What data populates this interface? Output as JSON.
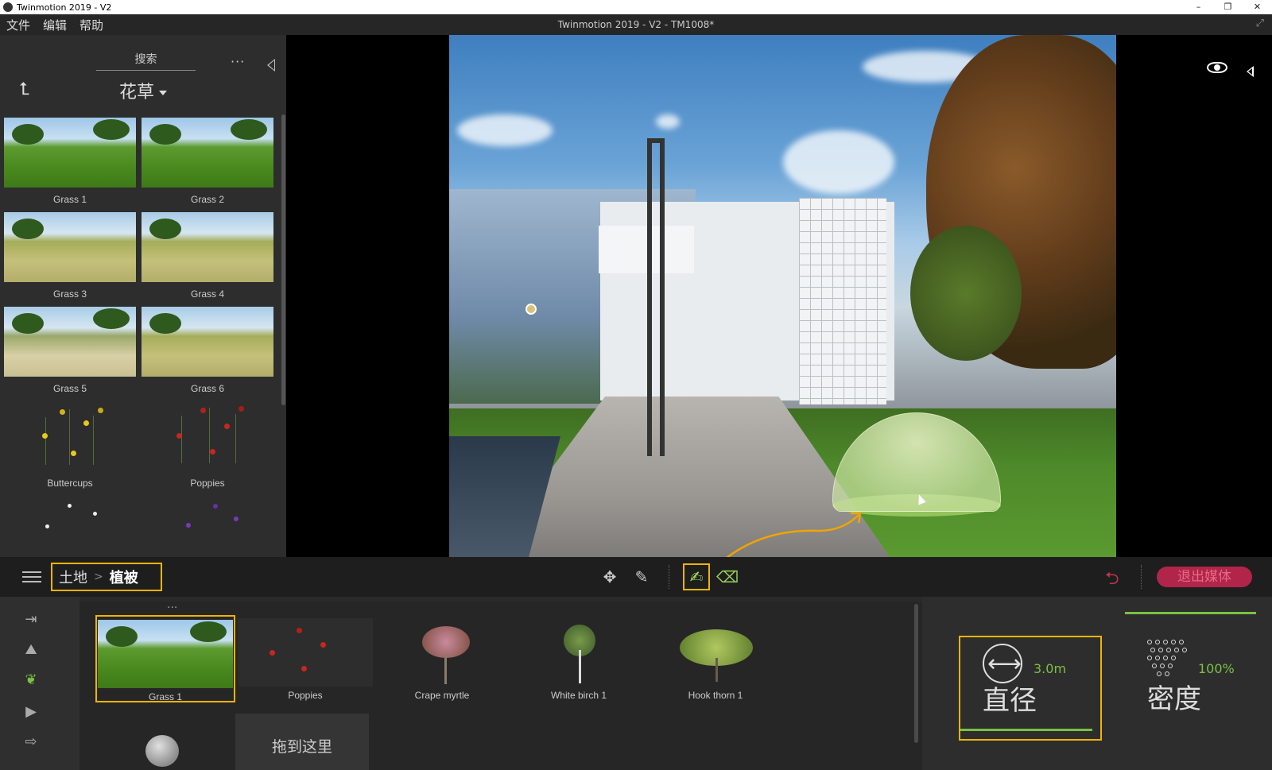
{
  "window": {
    "title": "Twinmotion 2019 - V2",
    "controls": [
      "–",
      "❐",
      "✕"
    ]
  },
  "menubar": {
    "items": [
      "文件",
      "编辑",
      "帮助"
    ],
    "doc_title": "Twinmotion 2019 - V2 - TM1008*"
  },
  "library": {
    "search_label": "搜索",
    "more_label": "···",
    "category": "花草",
    "items": [
      {
        "label": "Grass 1",
        "kind": "grass"
      },
      {
        "label": "Grass 2",
        "kind": "grass"
      },
      {
        "label": "Grass 3",
        "kind": "dry"
      },
      {
        "label": "Grass 4",
        "kind": "dry"
      },
      {
        "label": "Grass 5",
        "kind": "pale"
      },
      {
        "label": "Grass 6",
        "kind": "dry"
      },
      {
        "label": "Buttercups",
        "kind": "flower-yellow"
      },
      {
        "label": "Poppies",
        "kind": "flower-red"
      }
    ]
  },
  "toolbar": {
    "breadcrumb": [
      "土地",
      "植被"
    ],
    "exit_media_label": "退出媒体"
  },
  "assets": {
    "more_label": "···",
    "items": [
      {
        "label": "Grass 1",
        "selected": true
      },
      {
        "label": "Poppies",
        "selected": false
      },
      {
        "label": "Crape myrtle",
        "selected": false
      },
      {
        "label": "White birch 1",
        "selected": false
      },
      {
        "label": "Hook thorn 1",
        "selected": false
      }
    ],
    "drop_zone_label": "拖到这里"
  },
  "params": {
    "diameter": {
      "label": "直径",
      "value": "3.0m"
    },
    "density": {
      "label": "密度",
      "value": "100%"
    }
  },
  "colors": {
    "accent_highlight": "#f0b400",
    "accent_green": "#7ac143",
    "exit_button": "#b2254a",
    "panel": "#2d2d2d"
  },
  "icons": {
    "back": "back-arrow-icon",
    "move": "move-icon",
    "pen": "pen-icon",
    "brush": "brush-icon",
    "eraser": "eraser-icon",
    "undo": "undo-icon",
    "eye": "eye-icon"
  }
}
